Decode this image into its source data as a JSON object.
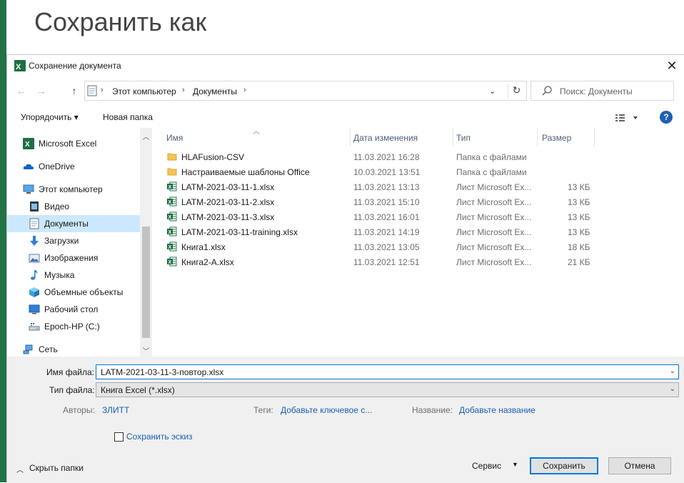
{
  "background": {
    "title": "Сохранить как",
    "accent": "#217346"
  },
  "dialog": {
    "title": "Сохранение документа",
    "close_label": "✕",
    "nav": {
      "back": "←",
      "forward": "→",
      "up": "↑",
      "breadcrumb": [
        "Этот компьютер",
        "Документы"
      ],
      "search_placeholder": "Поиск: Документы"
    },
    "toolbar": {
      "organize": "Упорядочить ▾",
      "new_folder": "Новая папка",
      "help": "?"
    },
    "sidebar": {
      "items": [
        {
          "label": "Microsoft Excel",
          "icon": "excel-icon"
        },
        {
          "label": "OneDrive",
          "icon": "cloud-icon"
        },
        {
          "label": "Этот компьютер",
          "icon": "computer-icon"
        },
        {
          "label": "Видео",
          "icon": "video-icon"
        },
        {
          "label": "Документы",
          "icon": "documents-icon",
          "selected": true
        },
        {
          "label": "Загрузки",
          "icon": "download-icon"
        },
        {
          "label": "Изображения",
          "icon": "pictures-icon"
        },
        {
          "label": "Музыка",
          "icon": "music-icon"
        },
        {
          "label": "Объемные объекты",
          "icon": "3d-objects-icon"
        },
        {
          "label": "Рабочий стол",
          "icon": "desktop-icon"
        },
        {
          "label": "Epoch-HP (C:)",
          "icon": "drive-icon"
        },
        {
          "label": "Сеть",
          "icon": "network-icon"
        }
      ]
    },
    "columns": {
      "name": "Имя",
      "date": "Дата изменения",
      "type": "Тип",
      "size": "Размер"
    },
    "files": [
      {
        "name": "HLAFusion-CSV",
        "date": "11.03.2021 16:28",
        "type": "Папка с файлами",
        "size": "",
        "kind": "folder"
      },
      {
        "name": "Настраиваемые шаблоны Office",
        "date": "10.03.2021 13:51",
        "type": "Папка с файлами",
        "size": "",
        "kind": "folder"
      },
      {
        "name": "LATM-2021-03-11-1.xlsx",
        "date": "11.03.2021 13:13",
        "type": "Лист Microsoft Ex...",
        "size": "13 КБ",
        "kind": "xlsx"
      },
      {
        "name": "LATM-2021-03-11-2.xlsx",
        "date": "11.03.2021 15:10",
        "type": "Лист Microsoft Ex...",
        "size": "13 КБ",
        "kind": "xlsx"
      },
      {
        "name": "LATM-2021-03-11-3.xlsx",
        "date": "11.03.2021 16:01",
        "type": "Лист Microsoft Ex...",
        "size": "13 КБ",
        "kind": "xlsx"
      },
      {
        "name": "LATM-2021-03-11-training.xlsx",
        "date": "11.03.2021 14:19",
        "type": "Лист Microsoft Ex...",
        "size": "13 КБ",
        "kind": "xlsx"
      },
      {
        "name": "Книга1.xlsx",
        "date": "11.03.2021 13:05",
        "type": "Лист Microsoft Ex...",
        "size": "18 КБ",
        "kind": "xlsx"
      },
      {
        "name": "Книга2-A.xlsx",
        "date": "11.03.2021 12:51",
        "type": "Лист Microsoft Ex...",
        "size": "21 КБ",
        "kind": "xlsx"
      }
    ],
    "form": {
      "filename_label": "Имя файла:",
      "filename_value": "LATM-2021-03-11-3-повтор.xlsx",
      "filetype_label": "Тип файла:",
      "filetype_value": "Книга Excel (*.xlsx)",
      "authors_label": "Авторы:",
      "authors_value": "ЗЛИТТ",
      "tags_label": "Теги:",
      "tags_value": "Добавьте ключевое с...",
      "title_label": "Название:",
      "title_value": "Добавьте название",
      "thumbnail_label": "Сохранить эскиз"
    },
    "footer": {
      "hide_folders": "Скрыть папки",
      "service": "Сервис",
      "save": "Сохранить",
      "cancel": "Отмена"
    }
  }
}
